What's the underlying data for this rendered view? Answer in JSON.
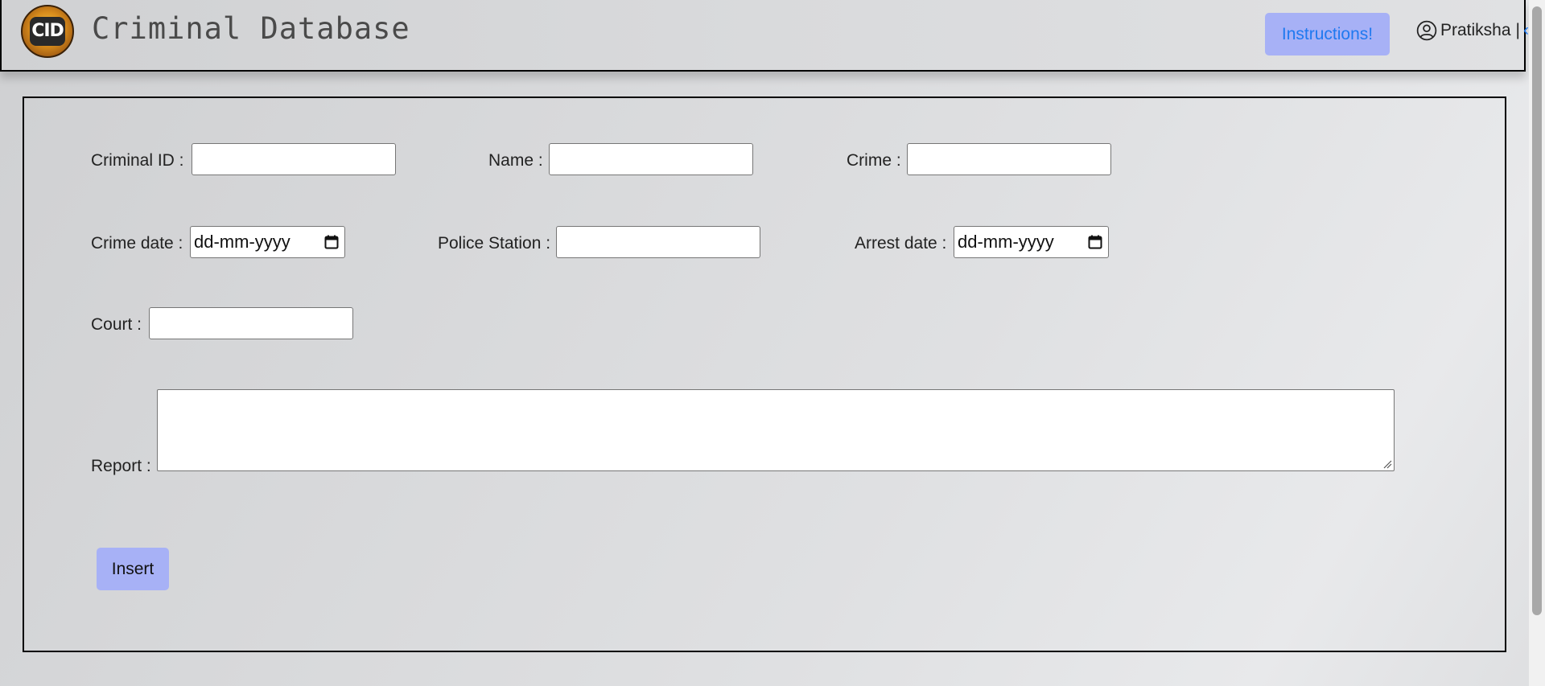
{
  "header": {
    "logo_text": "CID",
    "title": "Criminal Database",
    "instructions_label": "Instructions!",
    "user_name": "Pratiksha",
    "separator": "|",
    "trailing_glyph": "‹"
  },
  "form": {
    "criminal_id": {
      "label": "Criminal ID :",
      "value": ""
    },
    "name": {
      "label": "Name :",
      "value": ""
    },
    "crime": {
      "label": "Crime :",
      "value": ""
    },
    "crime_date": {
      "label": "Crime date :",
      "placeholder": "dd-mm-yyyy"
    },
    "police_station": {
      "label": "Police Station :",
      "value": ""
    },
    "arrest_date": {
      "label": "Arrest date :",
      "placeholder": "dd-mm-yyyy"
    },
    "court": {
      "label": "Court :",
      "value": ""
    },
    "report": {
      "label": "Report :",
      "value": ""
    },
    "insert_label": "Insert"
  },
  "colors": {
    "button_bg": "#a7b1f6",
    "link_blue": "#1f79f0"
  }
}
